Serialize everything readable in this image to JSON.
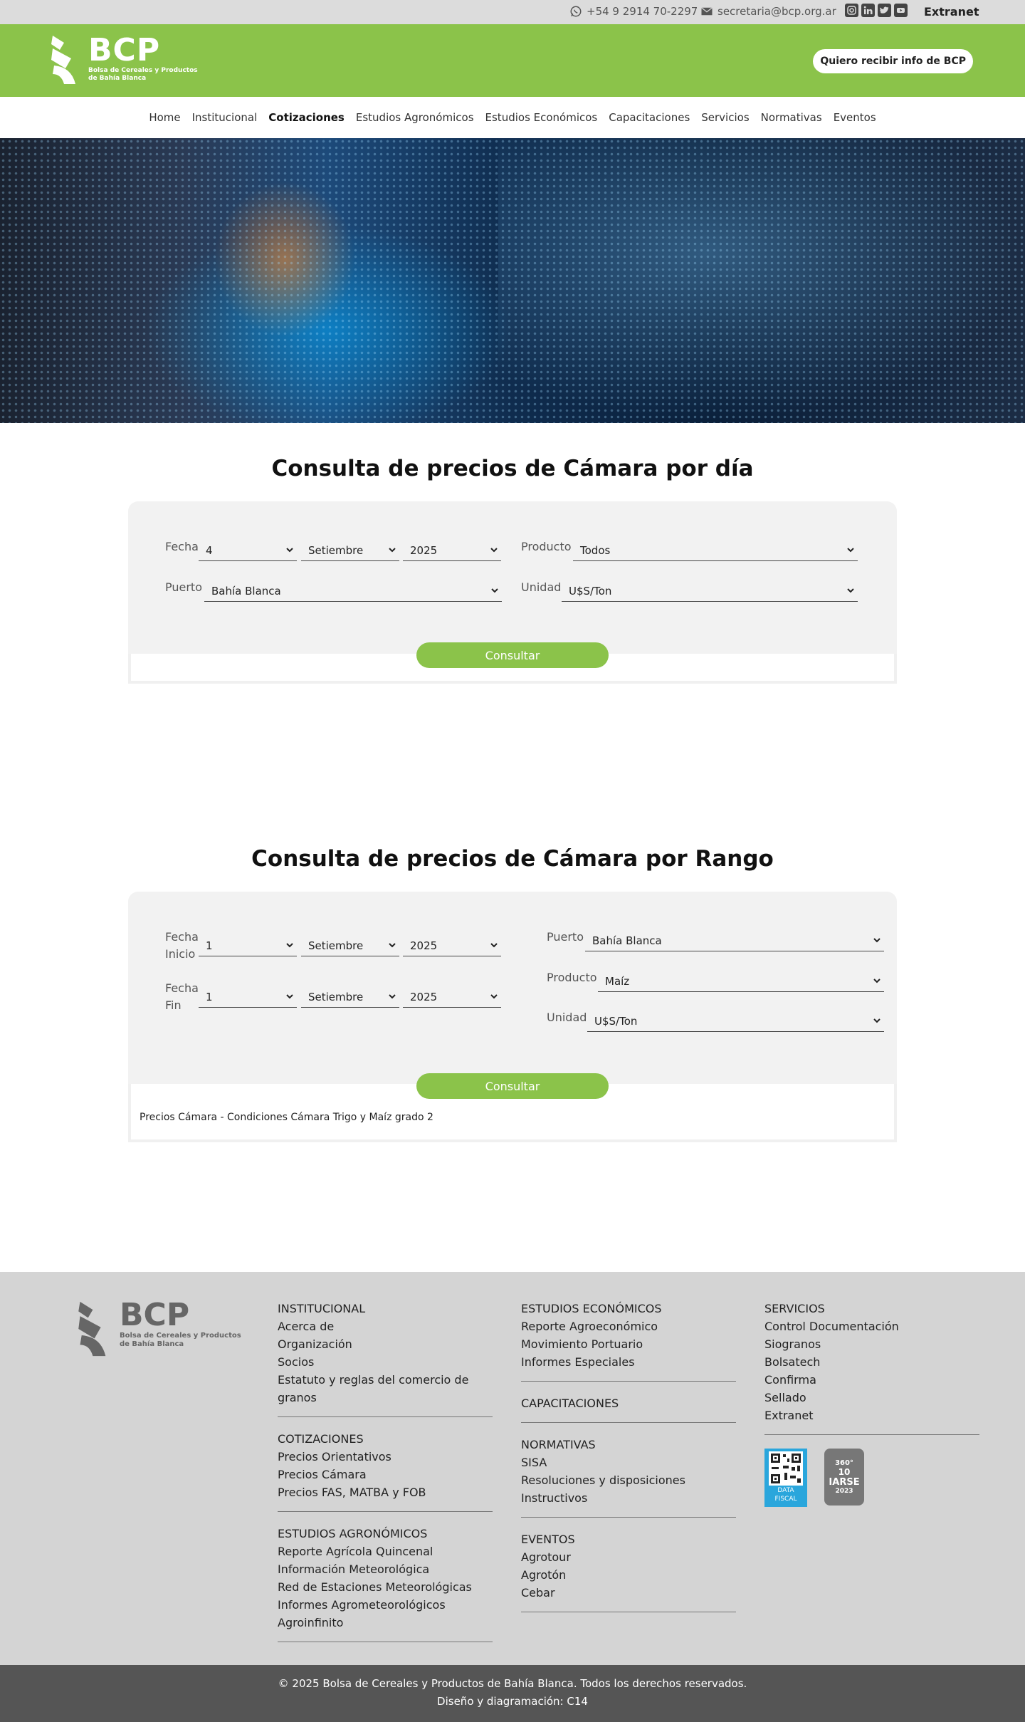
{
  "topbar": {
    "phone": "+54 9 2914 70-2297",
    "email": "secretaria@bcp.org.ar",
    "extranet": "Extranet"
  },
  "header": {
    "logo_text": "BCP",
    "logo_subtitle_1": "Bolsa de Cereales y Productos",
    "logo_subtitle_2": "de Bahía Blanca",
    "info_button": "Quiero recibir info de BCP",
    "brand_color": "#8bc34a"
  },
  "nav": {
    "items": [
      "Home",
      "Institucional",
      "Cotizaciones",
      "Estudios Agronómicos",
      "Estudios Económicos",
      "Capacitaciones",
      "Servicios",
      "Normativas",
      "Eventos"
    ],
    "active": "Cotizaciones"
  },
  "daily": {
    "title": "Consulta de precios de Cámara por día",
    "fecha_label": "Fecha",
    "day": "4",
    "month": "Setiembre",
    "year": "2025",
    "producto_label": "Producto",
    "producto": "Todos",
    "puerto_label": "Puerto",
    "puerto": "Bahía Blanca",
    "unidad_label": "Unidad",
    "unidad": "U$S/Ton",
    "button": "Consultar"
  },
  "range": {
    "title": "Consulta de precios de Cámara por Rango",
    "inicio_label_1": "Fecha",
    "inicio_label_2": "Inicio",
    "inicio_day": "1",
    "inicio_month": "Setiembre",
    "inicio_year": "2025",
    "fin_label_1": "Fecha",
    "fin_label_2": "Fin",
    "fin_day": "1",
    "fin_month": "Setiembre",
    "fin_year": "2025",
    "puerto_label": "Puerto",
    "puerto": "Bahía Blanca",
    "producto_label": "Producto",
    "producto": "Maíz",
    "unidad_label": "Unidad",
    "unidad": "U$S/Ton",
    "button": "Consultar",
    "note": "Precios Cámara - Condiciones Cámara Trigo y Maíz grado 2"
  },
  "footer": {
    "col1": [
      {
        "heading": "INSTITUCIONAL",
        "links": [
          "Acerca de",
          "Organización",
          "Socios",
          "Estatuto y reglas del comercio de granos"
        ]
      },
      {
        "heading": "COTIZACIONES",
        "links": [
          "Precios Orientativos",
          "Precios Cámara",
          "Precios FAS, MATBA y FOB"
        ]
      },
      {
        "heading": "ESTUDIOS AGRONÓMICOS",
        "links": [
          "Reporte Agrícola Quincenal",
          "Información Meteorológica",
          "Red de Estaciones Meteorológicas",
          "Informes Agrometeorológicos",
          "Agroinfinito"
        ]
      }
    ],
    "col2": [
      {
        "heading": "ESTUDIOS ECONÓMICOS",
        "links": [
          "Reporte Agroeconómico",
          "Movimiento Portuario",
          "Informes Especiales"
        ]
      },
      {
        "heading": "CAPACITACIONES",
        "links": []
      },
      {
        "heading": "NORMATIVAS",
        "links": [
          "SISA",
          "Resoluciones y disposiciones",
          "Instructivos"
        ]
      },
      {
        "heading": "EVENTOS",
        "links": [
          "Agrotour",
          "Agrotón",
          "Cebar"
        ]
      }
    ],
    "col3": [
      {
        "heading": "SERVICIOS",
        "links": [
          "Control Documentación",
          "Siogranos",
          "Bolsatech",
          "Confirma",
          "Sellado",
          "Extranet"
        ]
      }
    ],
    "badge1_label_1": "DATA",
    "badge1_label_2": "FISCAL",
    "badge2_label": "IARSE",
    "badge2_top": "360°",
    "badge2_num": "10",
    "badge2_year": "2023"
  },
  "copyright": {
    "line1": "© 2025 Bolsa de Cereales y Productos de Bahía Blanca. Todos los derechos reservados.",
    "line2": "Diseño y diagramación: C14"
  }
}
